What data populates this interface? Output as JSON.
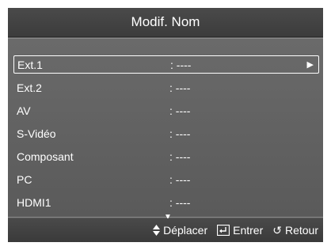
{
  "title": "Modif. Nom",
  "items": [
    {
      "label": "Ext.1",
      "value": ": ----",
      "arrow": "▶"
    },
    {
      "label": "Ext.2",
      "value": ": ----"
    },
    {
      "label": "AV",
      "value": ": ----"
    },
    {
      "label": "S-Vidéo",
      "value": ": ----"
    },
    {
      "label": "Composant",
      "value": ": ----"
    },
    {
      "label": "PC",
      "value": ": ----"
    },
    {
      "label": "HDMI1",
      "value": ": ----"
    }
  ],
  "scroll_indicator": "▼",
  "footer": {
    "move": {
      "icon": "▲▼",
      "label": "Déplacer"
    },
    "enter": {
      "label": "Entrer"
    },
    "back": {
      "icon": "↺",
      "label": "Retour"
    }
  },
  "colors": {
    "panel": "#5c5c5c",
    "text": "#ffffff"
  }
}
